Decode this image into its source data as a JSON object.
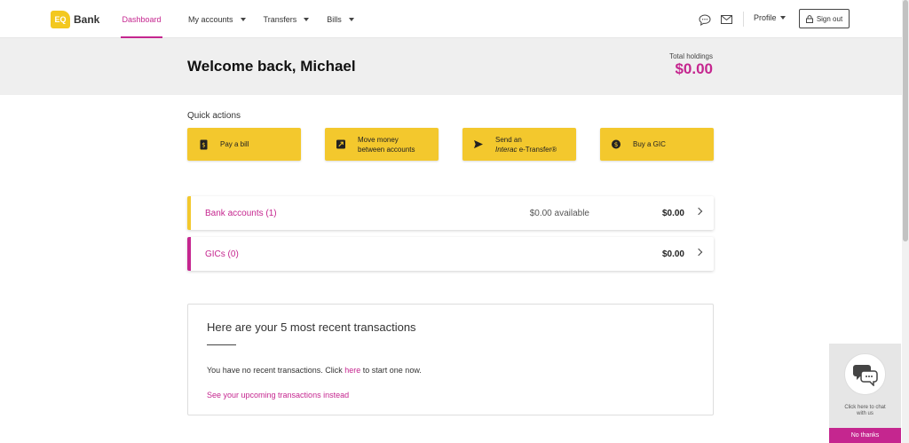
{
  "header": {
    "logo_mark": "EQ",
    "logo_text": "Bank",
    "nav": [
      {
        "label": "Dashboard",
        "active": true
      },
      {
        "label": "My accounts",
        "has_caret": true
      },
      {
        "label": "Transfers",
        "has_caret": true
      },
      {
        "label": "Bills",
        "has_caret": true
      }
    ],
    "icons": [
      "chat-icon",
      "mail-icon"
    ],
    "profile_label": "Profile",
    "signout_label": "Sign out"
  },
  "welcome": {
    "title": "Welcome back, Michael",
    "holdings_label": "Total holdings",
    "holdings_value": "$0.00"
  },
  "quick_actions": {
    "title": "Quick actions",
    "items": [
      {
        "line1": "Pay a bill",
        "line2": "",
        "icon": "bill-icon"
      },
      {
        "line1": "Move money",
        "line2": "between accounts",
        "icon": "transfer-icon"
      },
      {
        "line1": "Send an",
        "line2_italic": "Interac",
        "line2": " e-Transfer®",
        "icon": "send-icon"
      },
      {
        "line1": "Buy a GIC",
        "line2": "",
        "icon": "dollar-icon"
      }
    ]
  },
  "accounts": [
    {
      "name": "Bank accounts (1)",
      "available": "$0.00 available",
      "total": "$0.00",
      "color": "#f3c82d"
    },
    {
      "name": "GICs (0)",
      "available": "",
      "total": "$0.00",
      "color": "#c5268f"
    }
  ],
  "transactions": {
    "title": "Here are your 5 most recent transactions",
    "empty_prefix": "You have no recent transactions. Click ",
    "empty_link": "here",
    "empty_suffix": " to start one now.",
    "upcoming_link": "See your upcoming transactions instead"
  },
  "chat": {
    "text_line1": "Click here to chat",
    "text_line2": "with us",
    "dismiss": "No thanks"
  },
  "colors": {
    "accent": "#c5268f",
    "yellow": "#f3c82d"
  }
}
